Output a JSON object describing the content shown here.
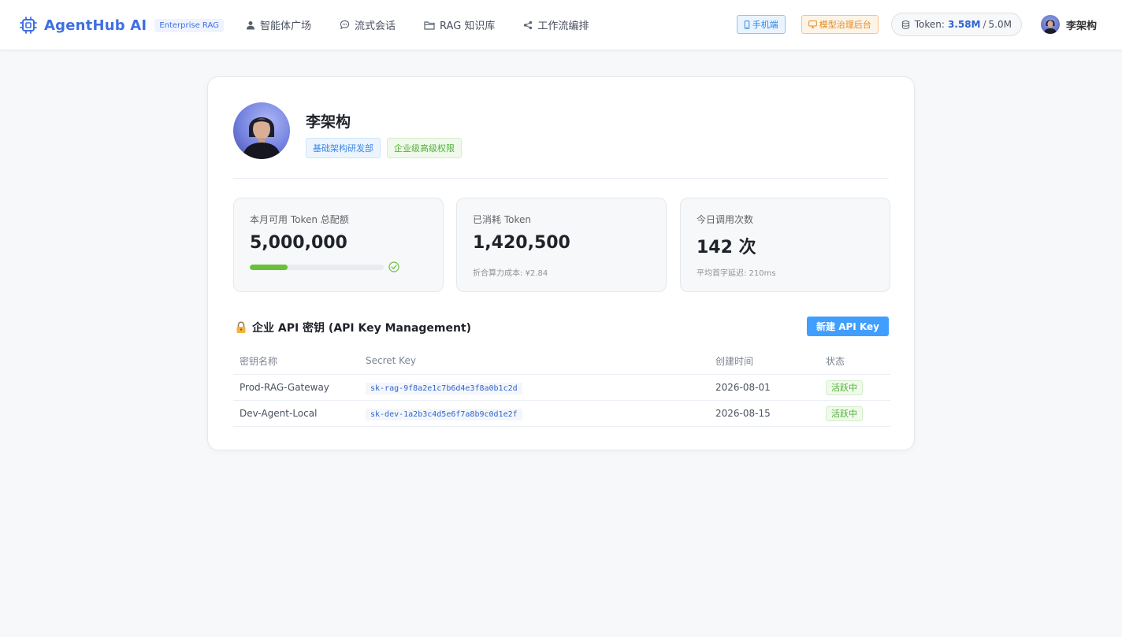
{
  "app": {
    "name": "AgentHub AI",
    "badge": "Enterprise RAG"
  },
  "nav": {
    "items": [
      {
        "label": "智能体广场",
        "icon": "user-icon"
      },
      {
        "label": "流式会话",
        "icon": "chat-bubble-icon"
      },
      {
        "label": "RAG 知识库",
        "icon": "folder-icon"
      },
      {
        "label": "工作流编排",
        "icon": "share-nodes-icon"
      }
    ]
  },
  "header": {
    "mobile_label": "手机端",
    "admin_label": "模型治理后台",
    "token_label": "Token:",
    "token_used": "3.58M",
    "token_separator": "/",
    "token_total": "5.0M",
    "user_name": "李架构"
  },
  "profile": {
    "name": "李架构",
    "department": "基础架构研发部",
    "permission": "企业级高级权限"
  },
  "stats": [
    {
      "label": "本月可用 Token 总配额",
      "value": "5,000,000",
      "usage_fraction": 0.28
    },
    {
      "label": "已消耗 Token",
      "value": "1,420,500",
      "sub": "折合算力成本: ¥2.84"
    },
    {
      "label": "今日调用次数",
      "value": "142 次",
      "sub": "平均首字延迟: 210ms"
    }
  ],
  "api": {
    "title": "企业 API 密钥 (API Key Management)",
    "new_button": "新建 API Key",
    "columns": [
      "密钥名称",
      "Secret Key",
      "创建时间",
      "状态"
    ],
    "rows": [
      {
        "name": "Prod-RAG-Gateway",
        "key": "sk-rag-9f8a2e1c7b6d4e3f8a0b1c2d",
        "created": "2026-08-01",
        "status": "活跃中"
      },
      {
        "name": "Dev-Agent-Local",
        "key": "sk-dev-1a2b3c4d5e6f7a8b9c0d1e2f",
        "created": "2026-08-15",
        "status": "活跃中"
      }
    ]
  },
  "colors": {
    "brand": "#3f6fe0",
    "primary_button": "#409eff",
    "success": "#67c23a",
    "warning": "#e08d28"
  }
}
